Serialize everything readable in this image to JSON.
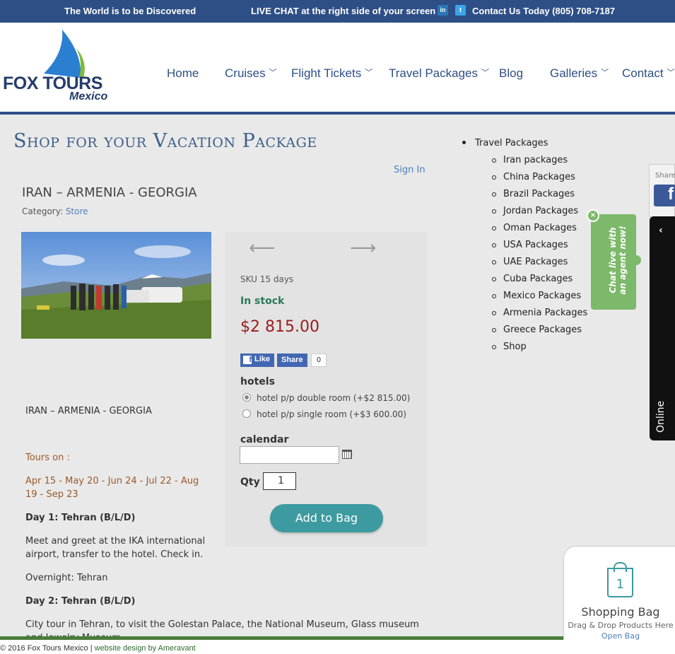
{
  "topbar": {
    "tagline": "The World is to be Discovered",
    "chat_notice": "LIVE CHAT at the right side of your screen",
    "contact_label": "Contact Us Today",
    "phone": "(805) 708-7187",
    "linkedin_icon": "in",
    "twitter_icon": "t"
  },
  "logo": {
    "name": "FOX TOURS",
    "sub": "Mexico"
  },
  "nav": {
    "items": [
      "Home",
      "Cruises",
      "Flight Tickets",
      "Travel Packages",
      "Blog",
      "Galleries",
      "Contact"
    ],
    "dropdown_marker": "﹀"
  },
  "page": {
    "title": "Shop for your Vacation Package",
    "sign_in": "Sign In"
  },
  "product": {
    "title": "IRAN – ARMENIA - GEORGIA",
    "category_label": "Category:",
    "category_value": "Store",
    "sku": "SKU 15 days",
    "stock": "In stock",
    "price": "$2 815.00",
    "like": "Like",
    "share": "Share",
    "share_count": "0",
    "hotels_label": "hotels",
    "option1": "hotel p/p double room (+$2 815.00)",
    "option2": "hotel p/p single room (+$3 600.00)",
    "calendar_label": "calendar",
    "calendar_value": "",
    "qty_label": "Qty",
    "qty_value": "1",
    "add_button": "Add to Bag",
    "prev_arrow": "⟵",
    "next_arrow": "⟶"
  },
  "description": {
    "subtitle": "IRAN – ARMENIA - GEORGIA",
    "tours_on": "Tours on :",
    "dates": "Apr 15 - May 20 - Jun 24 - Jul 22 - Aug 19 - Sep 23",
    "day1": "Day 1: Tehran (B/L/D)",
    "day1_text": "Meet and greet at the IKA international airport, transfer to the hotel. Check in.",
    "overnight": "Overnight: Tehran",
    "day2": "Day 2: Tehran (B/L/D)",
    "day2_text": "City tour in Tehran, to visit the Golestan Palace, the National Museum, Glass museum and Jewelry Museum"
  },
  "sidebar": {
    "heading": "Travel Packages",
    "items": [
      "Iran packages",
      "China Packages",
      "Brazil Packages",
      "Jordan Packages",
      "Oman Packages",
      "USA Packages",
      "UAE Packages",
      "Cuba Packages",
      "Mexico Packages",
      "Armenia Packages",
      "Greece Packages",
      "Shop"
    ]
  },
  "share_strip": {
    "label": "Share"
  },
  "chat": {
    "bubble": "Chat live with an agent now!",
    "close": "×",
    "collapse": "‹",
    "status": "Online"
  },
  "bag": {
    "count": "1",
    "title": "Shopping Bag",
    "hint": "Drag & Drop Products Here",
    "open": "Open Bag"
  },
  "footer": {
    "copyright": "© 2016 Fox Tours Mexico |",
    "credit": "website design by Ameravant"
  },
  "colors": {
    "brand_blue": "#2e4f86",
    "accent_teal": "#3d9aa0",
    "price_red": "#9b1c1c",
    "stock_green": "#2a7a56",
    "chat_green": "#7cb96a"
  }
}
